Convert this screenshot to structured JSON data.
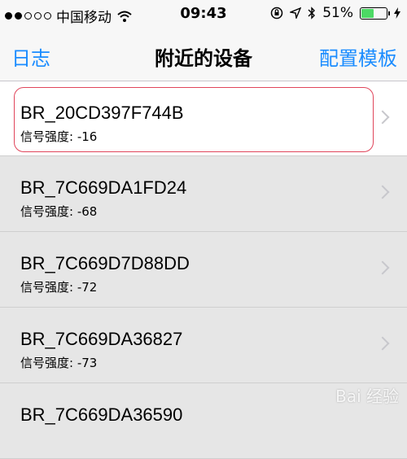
{
  "status_bar": {
    "carrier": "中国移动",
    "time": "09:43",
    "battery_percent": "51%",
    "battery_level": 0.51,
    "signal_icons": [
      "signal-dots-icon",
      "wifi-icon"
    ],
    "right_icons": [
      "rotation-lock-icon",
      "location-arrow-icon",
      "bluetooth-icon",
      "charging-bolt-icon"
    ]
  },
  "nav": {
    "left_button": "日志",
    "title": "附近的设备",
    "right_button": "配置模板",
    "accent_color": "#1a8cff"
  },
  "devices": [
    {
      "name": "BR_20CD397F744B",
      "signal": "信号强度: -16"
    },
    {
      "name": "BR_7C669DA1FD24",
      "signal": "信号强度: -68"
    },
    {
      "name": "BR_7C669D7D88DD",
      "signal": "信号强度: -72"
    },
    {
      "name": "BR_7C669DA36827",
      "signal": "信号强度: -73"
    },
    {
      "name": "BR_7C669DA36590",
      "signal": ""
    }
  ],
  "watermark": "Bai 经验"
}
